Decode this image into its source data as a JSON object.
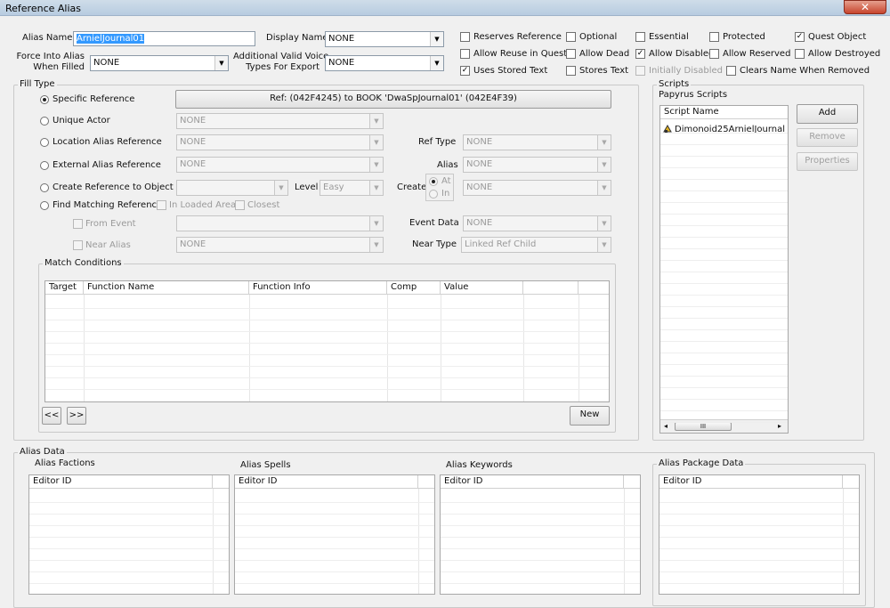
{
  "window": {
    "title": "Reference Alias",
    "close": "✕"
  },
  "top": {
    "alias_name_label": "Alias Name",
    "alias_name_value": "ArnielJournal01",
    "display_name_label": "Display Name",
    "display_name_value": "NONE",
    "force_label_1": "Force Into Alias",
    "force_label_2": "When Filled",
    "force_value": "NONE",
    "voice_label_1": "Additional Valid Voice",
    "voice_label_2": "Types For Export",
    "voice_value": "NONE"
  },
  "flags": {
    "reserves_reference": "Reserves Reference",
    "optional": "Optional",
    "essential": "Essential",
    "protected": "Protected",
    "quest_object": "Quest Object",
    "allow_reuse": "Allow Reuse in Quest",
    "allow_dead": "Allow Dead",
    "allow_disabled": "Allow Disabled",
    "allow_reserved": "Allow Reserved",
    "allow_destroyed": "Allow Destroyed",
    "uses_stored_text": "Uses Stored Text",
    "stores_text": "Stores Text",
    "initially_disabled": "Initially Disabled",
    "clears_name": "Clears Name When Removed",
    "check": "✓"
  },
  "fill": {
    "group_title": "Fill Type",
    "specific_reference": "Specific Reference",
    "ref_button": "Ref: (042F4245) to BOOK 'DwaSpJournal01' (042E4F39)",
    "unique_actor": "Unique Actor",
    "location_alias_reference": "Location Alias Reference",
    "external_alias_reference": "External Alias Reference",
    "create_reference": "Create Reference to Object",
    "find_matching": "Find Matching Reference",
    "in_loaded_area": "In Loaded Area",
    "closest": "Closest",
    "from_event": "From Event",
    "near_alias": "Near Alias",
    "none": "NONE",
    "ref_type_label": "Ref Type",
    "alias_label": "Alias",
    "level_label": "Level",
    "level_value": "Easy",
    "create_label": "Create",
    "at_label": "At",
    "in_label": "In",
    "event_data_label": "Event Data",
    "near_type_label": "Near Type",
    "near_type_value": "Linked Ref Child",
    "arrow": "▼"
  },
  "conditions": {
    "group_title": "Match Conditions",
    "columns": [
      "Target",
      "Function Name",
      "Function Info",
      "Comp",
      "Value",
      ""
    ],
    "prev": "<<",
    "next": ">>",
    "new": "New"
  },
  "scripts": {
    "group_title": "Scripts",
    "papyrus_label": "Papyrus Scripts",
    "column": "Script Name",
    "items": [
      "Dimonoid25ArnielJournal"
    ],
    "add": "Add",
    "remove": "Remove",
    "properties": "Properties",
    "scroll_left": "◂",
    "scroll_right": "▸",
    "thumb": "III"
  },
  "alias_data": {
    "group_title": "Alias Data",
    "factions": "Alias Factions",
    "spells": "Alias Spells",
    "keywords": "Alias Keywords",
    "package_data": "Alias Package Data",
    "editor_id": "Editor ID"
  }
}
